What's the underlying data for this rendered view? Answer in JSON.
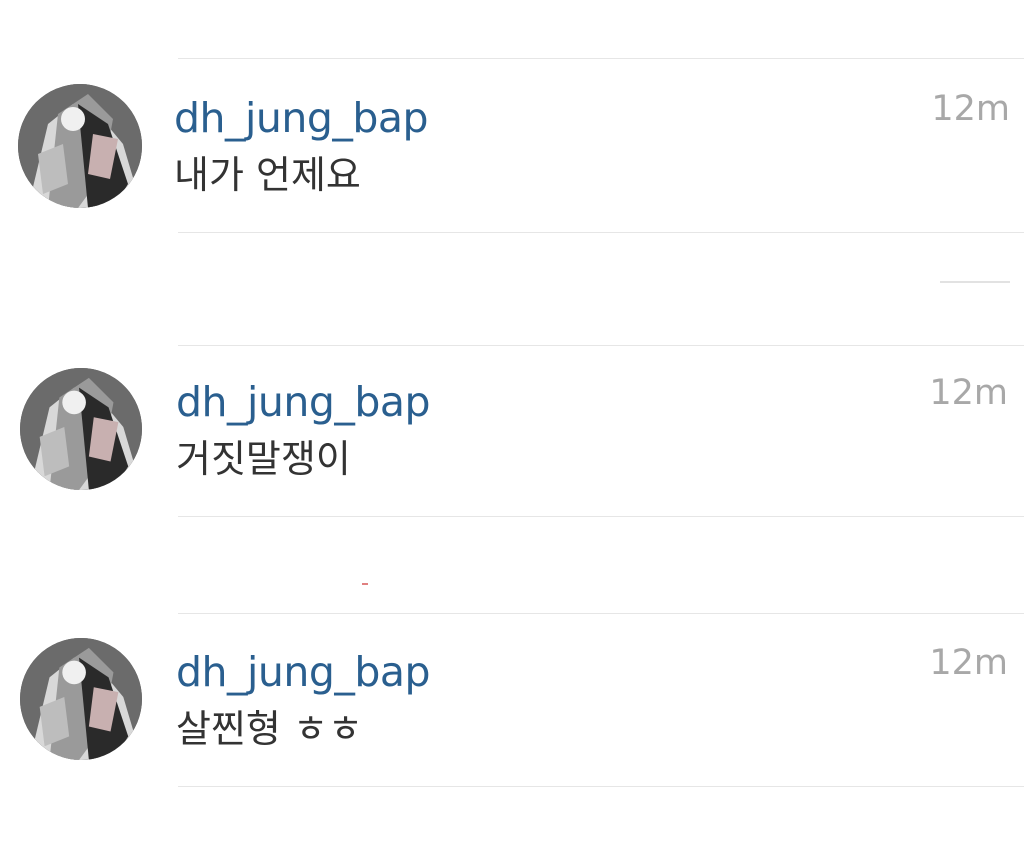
{
  "comments": [
    {
      "username": "dh_jung_bap",
      "text": "내가 언제요",
      "time": "12m",
      "avatar": "user-avatar-icon"
    },
    {
      "username": "dh_jung_bap",
      "text": "거짓말쟁이",
      "time": "12m",
      "avatar": "user-avatar-icon"
    },
    {
      "username": "dh_jung_bap",
      "text": "살찐형 ㅎㅎ",
      "time": "12m",
      "avatar": "user-avatar-icon"
    }
  ],
  "colors": {
    "username": "#2a5f8f",
    "text": "#333333",
    "time": "#a8a8a8",
    "divider": "#e6e6e6",
    "background": "#ffffff"
  }
}
